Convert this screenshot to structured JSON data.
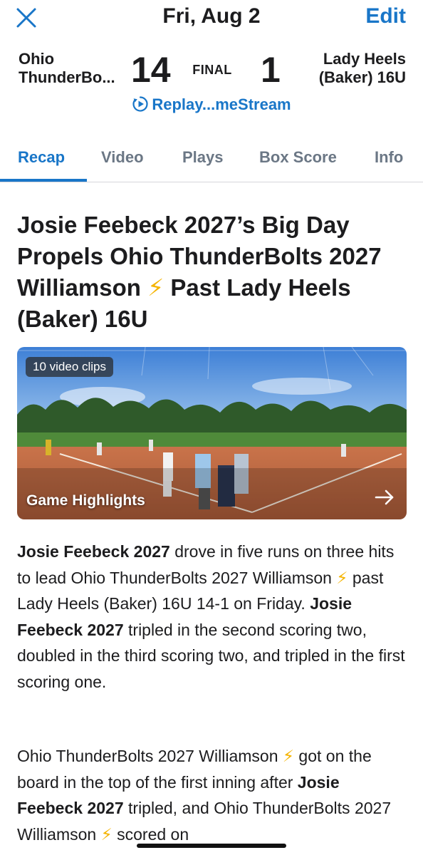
{
  "header": {
    "date": "Fri, Aug 2",
    "edit_label": "Edit",
    "close_icon": "close-icon"
  },
  "score": {
    "home_team_line1": "Ohio",
    "home_team_line2": "ThunderBo...",
    "home_score": "14",
    "status": "FINAL",
    "away_score": "1",
    "away_team_line1": "Lady Heels",
    "away_team_line2": "(Baker) 16U"
  },
  "replay": {
    "label": "Replay...meStream",
    "icon": "play-circle-icon"
  },
  "tabs": [
    "Recap",
    "Video",
    "Plays",
    "Box Score",
    "Info"
  ],
  "active_tab": "Recap",
  "article": {
    "headline_before": "Josie Feebeck 2027’s Big Day Propels Ohio ThunderBolts 2027 Williamson",
    "headline_emoji": "⚡",
    "headline_after": "Past Lady Heels (Baker) 16U",
    "video": {
      "clips_label": "10 video clips",
      "title": "Game Highlights",
      "arrow_icon": "arrow-right-icon"
    },
    "p1": {
      "b1": "Josie Feebeck 2027",
      "t1": " drove in five runs on three hits to lead Ohio ThunderBolts 2027 Williamson ",
      "emoji": "⚡",
      "t2": " past Lady Heels (Baker) 16U 14-1 on Friday. ",
      "b2": "Josie Feebeck 2027",
      "t3": " tripled in the second scoring two, doubled in the third scoring two, and tripled in the first scoring one."
    },
    "p2": {
      "t1": "Ohio ThunderBolts 2027 Williamson ",
      "emoji1": "⚡",
      "t2": " got on the board in the top of the first inning after ",
      "b1": "Josie Feebeck 2027",
      "t3": " tripled, and Ohio ThunderBolts 2027 Williamson ",
      "emoji2": "⚡",
      "t4": " scored on"
    }
  },
  "colors": {
    "accent": "#1976c8",
    "text": "#1c1c1e",
    "tab_inactive": "#6b7785",
    "bolt": "#f5b400"
  }
}
